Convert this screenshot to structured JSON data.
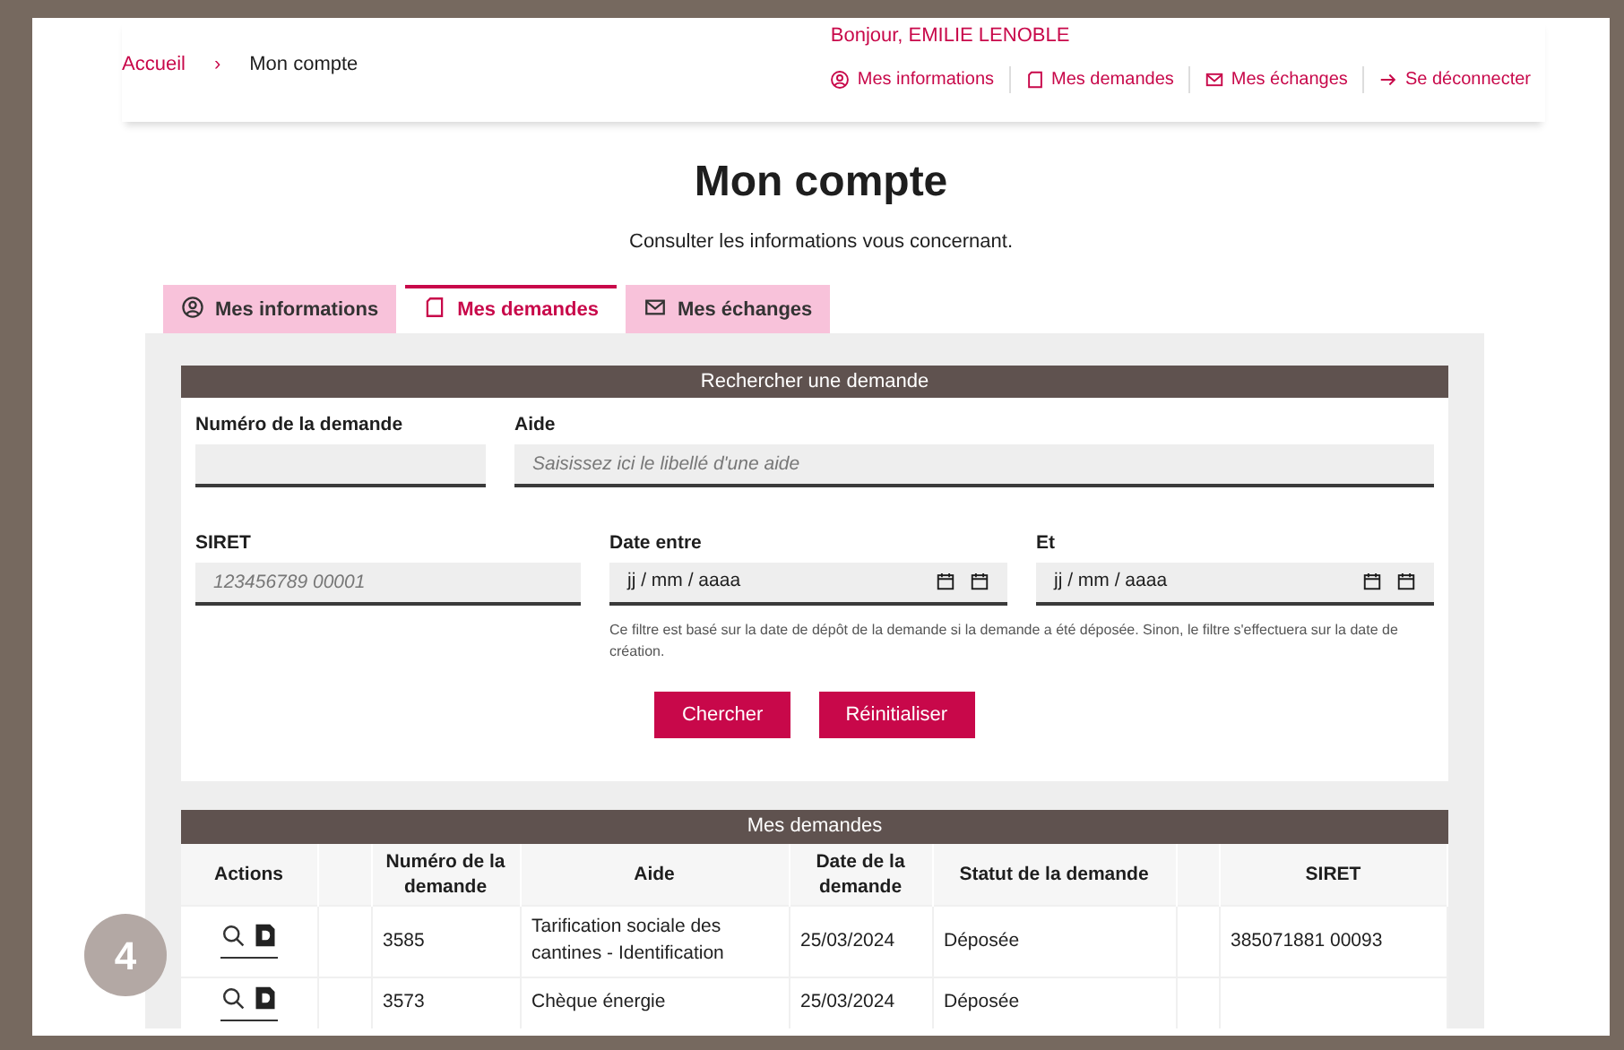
{
  "breadcrumb": {
    "separator": "›",
    "items": [
      {
        "label": "Accueil",
        "current": false
      },
      {
        "label": "Mon compte",
        "current": true
      }
    ]
  },
  "greeting": "Bonjour, EMILIE LENOBLE",
  "user_links": [
    "Mes informations",
    "Mes demandes",
    "Mes échanges",
    "Se déconnecter"
  ],
  "page_title": "Mon compte",
  "subtitle": "Consulter les informations vous concernant.",
  "tabs": [
    {
      "label": "Mes informations",
      "selected": false
    },
    {
      "label": "Mes demandes",
      "selected": true
    },
    {
      "label": "Mes échanges",
      "selected": false
    }
  ],
  "search": {
    "title": "Rechercher une demande",
    "fields": [
      {
        "label": "Numéro de la demande",
        "kind": "text"
      },
      {
        "label": "Aide",
        "kind": "text",
        "placeholder": "Saisissez ici le libellé d'une aide"
      },
      {
        "label": "SIRET",
        "kind": "text",
        "placeholder": "123456789 00001"
      },
      {
        "label": "Date entre",
        "kind": "date",
        "value": "jj / mm / aaaa"
      },
      {
        "label": "Et",
        "kind": "date",
        "value": "jj / mm / aaaa"
      }
    ],
    "hint": "Ce filtre est basé sur la date de dépôt de la demande si la demande a été déposée. Sinon, le filtre s'effectuera sur la date de création.",
    "buttons": [
      "Chercher",
      "Réinitialiser"
    ]
  },
  "table": {
    "title": "Mes demandes",
    "columns": [
      "Actions",
      "",
      "Numéro de la demande",
      "Aide",
      "Date de la demande",
      "Statut de la demande",
      "",
      "SIRET"
    ],
    "rows": [
      {
        "number": "3585",
        "aide": "Tarification sociale des cantines - Identification",
        "date": "25/03/2024",
        "status": "Déposée",
        "siret": "385071881 00093"
      },
      {
        "number": "3573",
        "aide": "Chèque énergie",
        "date": "25/03/2024",
        "status": "Déposée",
        "siret": ""
      }
    ]
  },
  "step_badge": "4"
}
